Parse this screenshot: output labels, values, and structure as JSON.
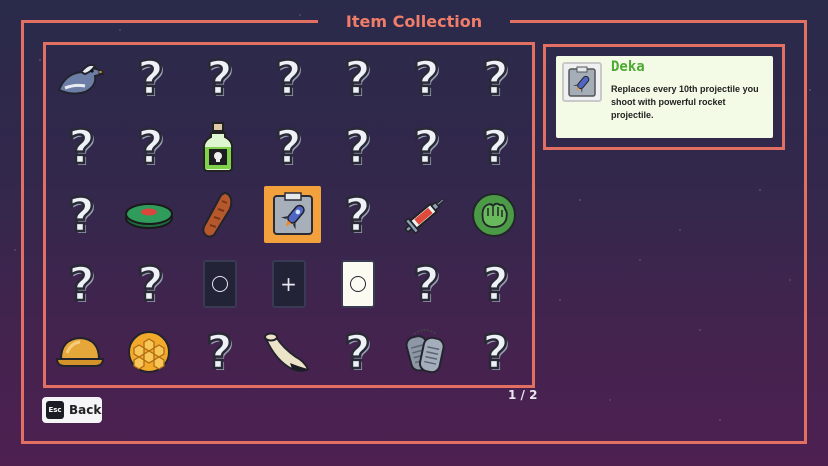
{
  "title": "Item Collection",
  "page_indicator": "1 / 2",
  "back_button": {
    "key": "Esc",
    "label": "Back"
  },
  "selected_item": {
    "name": "Deka",
    "description": "Replaces every 10th projectile you shoot with powerful rocket projectile.",
    "icon": "rocket-card-icon"
  },
  "grid": {
    "rows": [
      [
        "bird-icon",
        "unknown",
        "unknown",
        "unknown",
        "unknown",
        "unknown",
        "unknown"
      ],
      [
        "unknown",
        "unknown",
        "poison-bottle-icon",
        "unknown",
        "unknown",
        "unknown",
        "unknown"
      ],
      [
        "unknown",
        "green-button-icon",
        "bread-icon",
        "rocket-card-icon",
        "unknown",
        "syringe-icon",
        "green-fist-icon"
      ],
      [
        "unknown",
        "unknown",
        "dark-circle-card-icon",
        "dark-plus-card-icon",
        "light-circle-card-icon",
        "unknown",
        "unknown"
      ],
      [
        "helmet-icon",
        "honeycomb-icon",
        "unknown",
        "horn-icon",
        "unknown",
        "dog-tags-icon",
        "unknown"
      ]
    ],
    "selected": {
      "row": 2,
      "col": 3
    },
    "unknown_glyph": "?"
  },
  "colors": {
    "frame": "#e27062",
    "title": "#f07d6a",
    "selected_bg": "#f2a13c",
    "item_name": "#4caa32",
    "info_bg": "#f3fae6"
  }
}
